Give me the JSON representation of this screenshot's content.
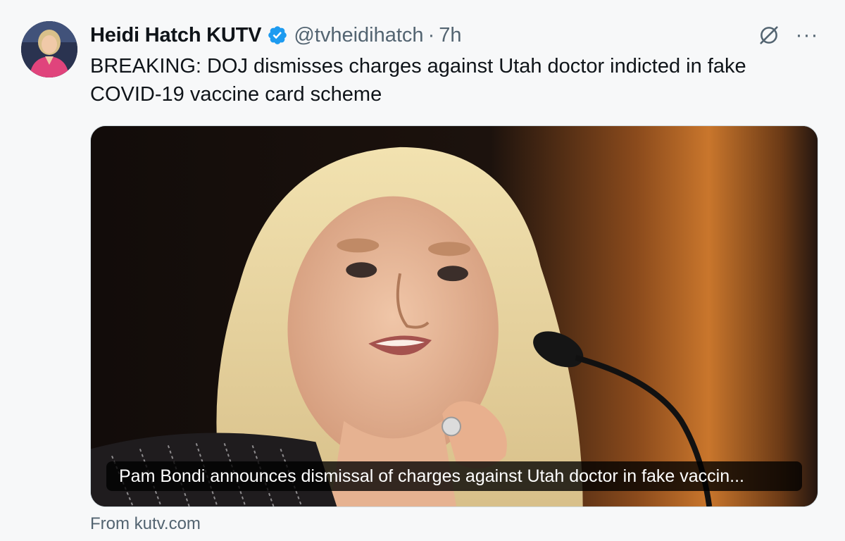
{
  "author": {
    "display_name": "Heidi Hatch KUTV",
    "handle": "@tvheidihatch",
    "separator": "·",
    "time": "7h"
  },
  "tweet": {
    "text": "BREAKING: DOJ dismisses charges against Utah doctor indicted in fake COVID-19 vaccine card scheme"
  },
  "card": {
    "caption": "Pam Bondi announces dismissal of charges against Utah doctor in fake vaccin...",
    "source": "From kutv.com"
  },
  "actions": {
    "more_label": "···"
  },
  "icons": {
    "verified": "verified-badge-icon",
    "grok": "grok-icon",
    "more": "more-options-icon"
  },
  "colors": {
    "verified_blue": "#1d9bf0",
    "secondary_text": "#536471",
    "primary_text": "#0f1419",
    "background": "#f7f8f9"
  }
}
